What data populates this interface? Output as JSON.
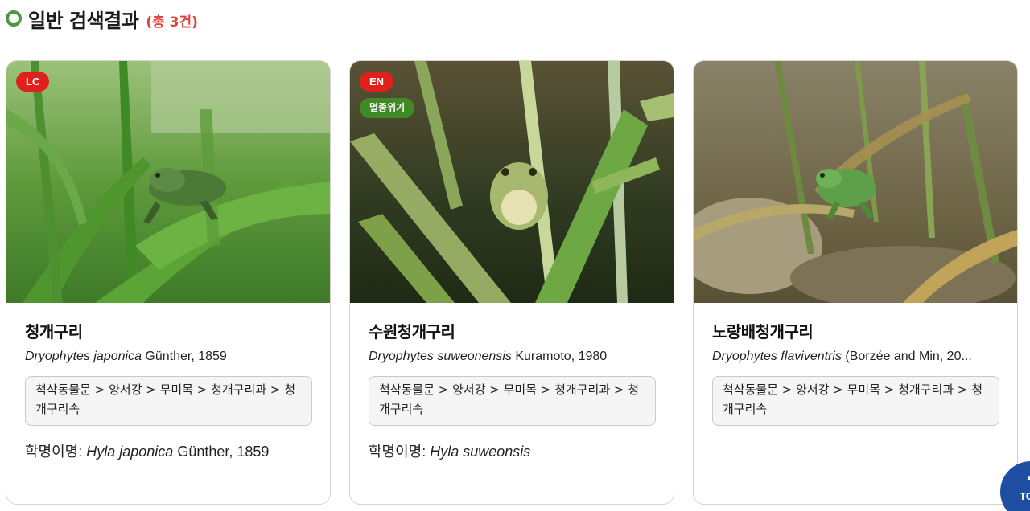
{
  "section": {
    "title": "일반 검색결과",
    "count": "(총 3건)"
  },
  "cards": [
    {
      "status_badge": "LC",
      "extra_badge": "",
      "korean_name": "청개구리",
      "sci_genus_species": "Dryophytes japonica",
      "sci_author": " Günther, 1859",
      "taxonomy": "척삭동물문 > 양서강 > 무미목 > 청개구리과 > 청개구리속",
      "synonym_label": "학명이명: ",
      "synonym_name": "Hyla japonica",
      "synonym_author": " Günther, 1859"
    },
    {
      "status_badge": "EN",
      "extra_badge": "멸종위기",
      "korean_name": "수원청개구리",
      "sci_genus_species": "Dryophytes suweonensis",
      "sci_author": " Kuramoto, 1980",
      "taxonomy": "척삭동물문 > 양서강 > 무미목 > 청개구리과 > 청개구리속",
      "synonym_label": "학명이명: ",
      "synonym_name": "Hyla suweonsis",
      "synonym_author": ""
    },
    {
      "status_badge": "",
      "extra_badge": "",
      "korean_name": "노랑배청개구리",
      "sci_genus_species": "Dryophytes flaviventris",
      "sci_author": " (Borzée and Min, 20...",
      "taxonomy": "척삭동물문 > 양서강 > 무미목 > 청개구리과 > 청개구리속",
      "synonym_label": "",
      "synonym_name": "",
      "synonym_author": ""
    }
  ],
  "top_button": {
    "label": "TOP",
    "icon": "arrow-up-icon"
  },
  "colors": {
    "accent_green": "#4a9a3e",
    "count_red": "#e0403a",
    "badge_red": "#e0211b",
    "badge_green": "#3f8a25",
    "top_button_blue": "#1e4ea1"
  }
}
